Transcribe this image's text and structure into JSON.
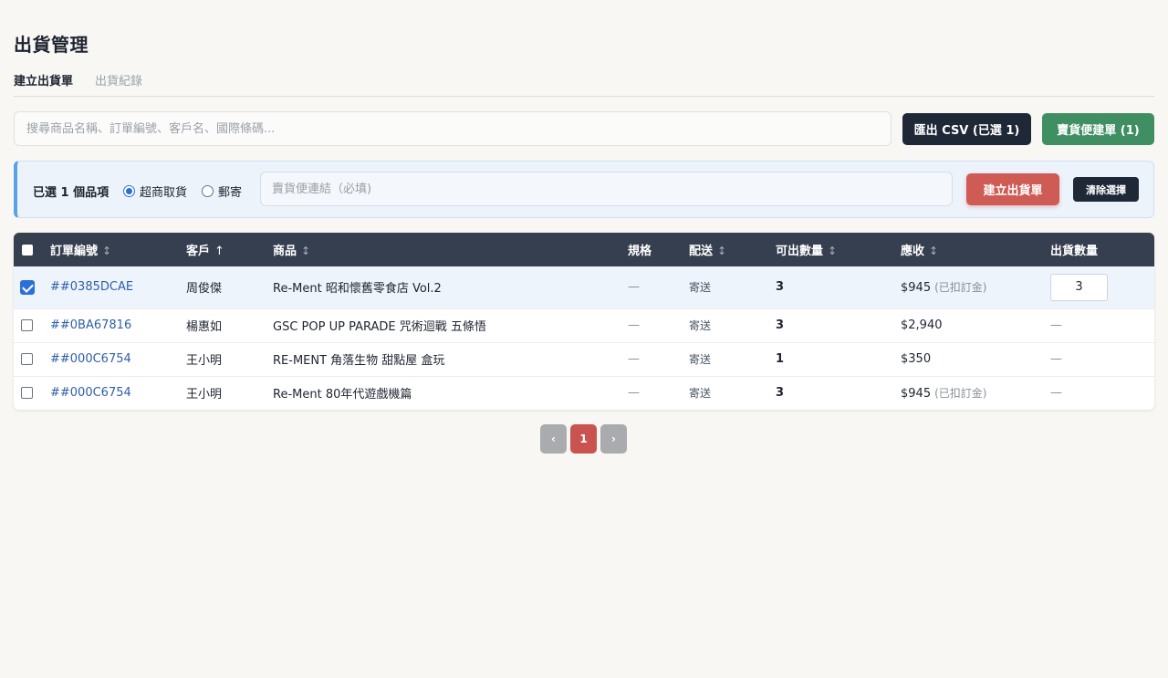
{
  "page_title": "出貨管理",
  "tabs": [
    {
      "label": "建立出貨單",
      "active": true
    },
    {
      "label": "出貨紀錄",
      "active": false
    }
  ],
  "search": {
    "placeholder": "搜尋商品名稱、訂單編號、客戶名、國際條碼...",
    "value": ""
  },
  "toolbar": {
    "export_label": "匯出 CSV (已選 1)",
    "sell_link_label": "賣貨便建單 (1)"
  },
  "selection": {
    "count_label": "已選 1 個品項",
    "options": [
      {
        "label": "超商取貨",
        "checked": true
      },
      {
        "label": "郵寄",
        "checked": false
      }
    ],
    "link_placeholder": "賣貨便連結（必填)",
    "create_label": "建立出貨單",
    "clear_label": "清除選擇"
  },
  "table": {
    "headers": {
      "order": "訂單編號",
      "customer": "客戶",
      "product": "商品",
      "spec": "規格",
      "delivery": "配送",
      "available": "可出數量",
      "receivable": "應收",
      "ship_qty": "出貨數量"
    },
    "sort_icons": {
      "neutral": "↕",
      "ascending": "↑"
    },
    "rows": [
      {
        "selected": true,
        "order_id": "##0385DCAE",
        "customer": "周俊傑",
        "product": "Re-Ment 昭和懷舊零食店 Vol.2",
        "spec": "—",
        "delivery": "寄送",
        "available": "3",
        "receivable": "$945",
        "deposit_note": "(已扣訂金)",
        "ship_qty": "3"
      },
      {
        "selected": false,
        "order_id": "##0BA67816",
        "customer": "楊惠如",
        "product": "GSC POP UP PARADE 咒術迴戰 五條悟",
        "spec": "—",
        "delivery": "寄送",
        "available": "3",
        "receivable": "$2,940",
        "deposit_note": "",
        "ship_qty": "—"
      },
      {
        "selected": false,
        "order_id": "##000C6754",
        "customer": "王小明",
        "product": "RE-MENT 角落生物 甜點屋 盒玩",
        "spec": "—",
        "delivery": "寄送",
        "available": "1",
        "receivable": "$350",
        "deposit_note": "",
        "ship_qty": "—"
      },
      {
        "selected": false,
        "order_id": "##000C6754",
        "customer": "王小明",
        "product": "Re-Ment 80年代遊戲機篇",
        "spec": "—",
        "delivery": "寄送",
        "available": "3",
        "receivable": "$945",
        "deposit_note": "(已扣訂金)",
        "ship_qty": "—"
      }
    ]
  },
  "pagination": {
    "prev": "‹",
    "current": "1",
    "next": "›"
  },
  "colors": {
    "header_bg": "#363f4f",
    "dark_button": "#1e2837",
    "green_button": "#3f8f63",
    "red_button": "#cf5b55",
    "link": "#2e5fa8",
    "selection_accent": "#5aa1e8"
  }
}
